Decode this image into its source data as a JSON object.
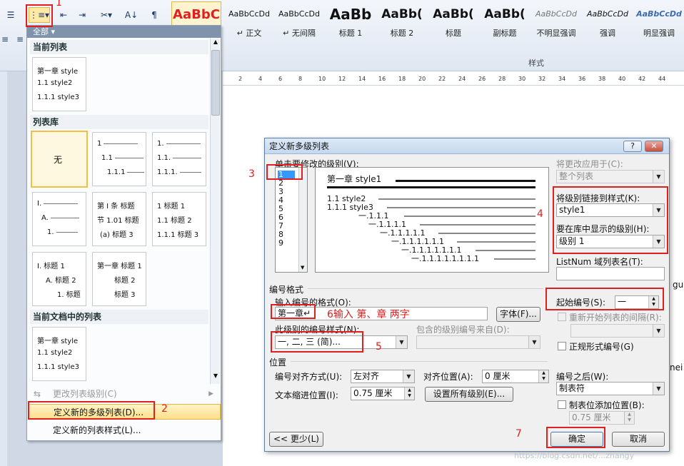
{
  "ribbon": {
    "styles": [
      {
        "sample": "AaBbC",
        "name": ""
      },
      {
        "sample": "AaBbCcDd",
        "name": "↵ 正文"
      },
      {
        "sample": "AaBbCcDd",
        "name": "↵ 无间隔"
      },
      {
        "sample": "AaBb",
        "name": "标题 1"
      },
      {
        "sample": "AaBb(",
        "name": "标题 2"
      },
      {
        "sample": "AaBb(",
        "name": "标题"
      },
      {
        "sample": "AaBb(",
        "name": "副标题"
      },
      {
        "sample": "AaBbCcDd",
        "name": "不明显强调"
      },
      {
        "sample": "AaBbCcDd",
        "name": "强调"
      },
      {
        "sample": "AaBbCcDd",
        "name": "明显强调"
      }
    ],
    "group_label": "样式"
  },
  "ruler": [
    "2",
    "4",
    "6",
    "8",
    "10",
    "12",
    "14",
    "16",
    "18",
    "20",
    "22",
    "24",
    "26",
    "28",
    "30",
    "32",
    "34",
    "36",
    "38",
    "40",
    "42",
    "44"
  ],
  "gallery": {
    "header": "全部 ▾",
    "current_list_label": "当前列表",
    "library_label": "列表库",
    "doc_lists_label": "当前文档中的列表",
    "none_label": "无",
    "thumb_current": [
      "第一章 style",
      "1.1 style2",
      "1.1.1 style3"
    ],
    "thumb_num": [
      "1",
      "1.1",
      "1.1.1"
    ],
    "thumb_num2": [
      "1.",
      "1.1.",
      "1.1.1."
    ],
    "thumb_roman": [
      "I.",
      "A.",
      "1."
    ],
    "thumb_article": [
      "第 I 条 标题",
      "节 1.01 标题",
      "(a) 标题 3"
    ],
    "thumb_heading1": [
      "1 标题 1",
      "1.1 标题 2",
      "1.1.1 标题 3"
    ],
    "thumb_heading2": [
      "I. 标题 1",
      "A. 标题 2",
      "1. 标题"
    ],
    "thumb_chapter": [
      "第一章 标题 1",
      "标题 2",
      "标题 3"
    ],
    "thumb_doc": [
      "第一章 style",
      "1.1 style2",
      "1.1.1 style3"
    ],
    "menu_change_level": "更改列表级别(C)",
    "menu_define_multilevel": "定义新的多级列表(D)...",
    "menu_define_style": "定义新的列表样式(L)..."
  },
  "dialog": {
    "title": "定义新多级列表",
    "help_btn": "?",
    "close_btn": "✕",
    "click_level_label": "单击要修改的级别(V):",
    "levels": [
      "1",
      "2",
      "3",
      "4",
      "5",
      "6",
      "7",
      "8",
      "9"
    ],
    "preview": [
      "第一章 style1",
      "1.1 style2",
      "1.1.1 style3",
      "一.1.1.1",
      "一.1.1.1.1",
      "一.1.1.1.1.1",
      "一.1.1.1.1.1.1",
      "一.1.1.1.1.1.1.1",
      "一.1.1.1.1.1.1.1.1"
    ],
    "apply_to_label": "将更改应用于(C):",
    "apply_to_value": "整个列表",
    "link_style_label": "将级别链接到样式(K):",
    "link_style_value": "style1",
    "gallery_level_label": "要在库中显示的级别(H):",
    "gallery_level_value": "级别 1",
    "listnum_label": "ListNum 域列表名(T):",
    "listnum_value": "",
    "number_format_group": "编号格式",
    "enter_format_label": "输入编号的格式(O):",
    "enter_format_value": "第一章↵",
    "font_btn": "字体(F)...",
    "number_style_label": "此级别的编号样式(N):",
    "number_style_value": "一, 二, 三 (简)...",
    "include_from_label": "包含的级别编号来自(D):",
    "include_from_value": "",
    "start_at_label": "起始编号(S):",
    "start_at_value": "一",
    "restart_label": "重新开始列表的间隔(R):",
    "restart_value": "",
    "legal_label": "正规形式编号(G)",
    "position_group": "位置",
    "align_label": "编号对齐方式(U):",
    "align_value": "左对齐",
    "align_at_label": "对齐位置(A):",
    "align_at_value": "0 厘米",
    "indent_label": "文本缩进位置(I):",
    "indent_value": "0.75 厘米",
    "set_all_btn": "设置所有级别(E)...",
    "follow_label": "编号之后(W):",
    "follow_value": "制表符",
    "tab_stop_label": "制表位添加位置(B):",
    "tab_stop_value": "0.75 厘米",
    "less_btn": "<< 更少(L)",
    "ok_btn": "确定",
    "cancel_btn": "取消"
  },
  "annotations": {
    "n1": "1",
    "n2": "2",
    "n3": "3",
    "n4": "4",
    "n5": "5",
    "n6": "6输入 第、章 两字",
    "n7": "7"
  },
  "doc_fragments": {
    "right1": "guo",
    "right2": "nei"
  },
  "watermark": "https://blog.csdn.net/...zhangy",
  "colors": {
    "accent_red": "#e0201f",
    "ribbon_bg": "#dfe7f2",
    "highlight": "#ffe08a",
    "selection": "#3399ff"
  }
}
